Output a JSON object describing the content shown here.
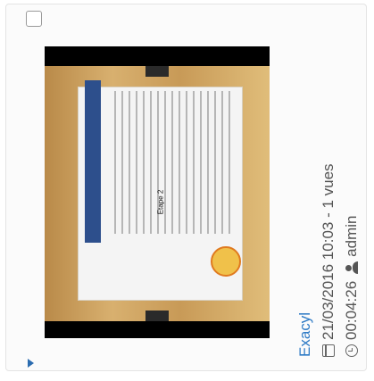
{
  "video": {
    "title": "Exacyl",
    "date_views": "21/03/2016 10:03 - 1 vues",
    "duration": "00:04:26",
    "author": "admin"
  },
  "thumbnail": {
    "slide_label": "Etape 2"
  },
  "icons": {
    "date": "calendar-icon",
    "duration": "clock-icon",
    "author": "user-icon",
    "expand": "triangle-right-icon"
  }
}
